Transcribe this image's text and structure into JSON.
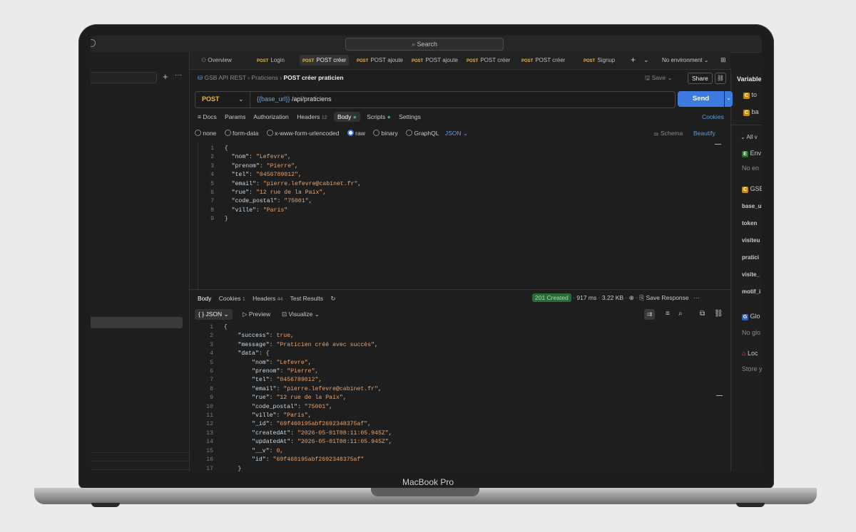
{
  "device": {
    "brand": "MacBook Pro"
  },
  "titlebar": {
    "search_placeholder": "Search"
  },
  "tabs": [
    {
      "method": "",
      "label": "Overview",
      "icon": "people-icon"
    },
    {
      "method": "POST",
      "label": "Login"
    },
    {
      "method": "POST",
      "label": "POST créer"
    },
    {
      "method": "POST",
      "label": "POST ajoute"
    },
    {
      "method": "POST",
      "label": "POST ajoute"
    },
    {
      "method": "POST",
      "label": "POST créer"
    },
    {
      "method": "POST",
      "label": "POST créer"
    },
    {
      "method": "POST",
      "label": "Signup"
    }
  ],
  "environment": {
    "label": "No environment"
  },
  "breadcrumb": {
    "collection": "GSB API REST",
    "folder": "Praticiens",
    "current": "POST créer praticien",
    "save": "Save",
    "share": "Share"
  },
  "request": {
    "method": "POST",
    "url_var": "{{base_url}}",
    "url_path": " /api/praticiens",
    "send": "Send"
  },
  "req_tabs": {
    "docs": "Docs",
    "params": "Params",
    "authorization": "Authorization",
    "headers": "Headers",
    "headers_count": "12",
    "body": "Body",
    "scripts": "Scripts",
    "settings": "Settings",
    "cookies": "Cookies"
  },
  "body_types": {
    "none": "none",
    "form_data": "form-data",
    "urlencoded": "x-www-form-urlencoded",
    "raw": "raw",
    "binary": "binary",
    "graphql": "GraphQL",
    "json": "JSON",
    "schema": "Schema",
    "beautify": "Beautify"
  },
  "request_body": [
    {
      "n": "1",
      "parts": [
        [
          "punc",
          "{"
        ]
      ]
    },
    {
      "n": "2",
      "parts": [
        [
          "key",
          "  \"nom\""
        ],
        [
          "punc",
          ": "
        ],
        [
          "str",
          "\"Lefevre\""
        ],
        [
          "punc",
          ","
        ]
      ]
    },
    {
      "n": "3",
      "parts": [
        [
          "key",
          "  \"prenom\""
        ],
        [
          "punc",
          ": "
        ],
        [
          "str",
          "\"Pierre\""
        ],
        [
          "punc",
          ","
        ]
      ]
    },
    {
      "n": "4",
      "parts": [
        [
          "key",
          "  \"tel\""
        ],
        [
          "punc",
          ": "
        ],
        [
          "str",
          "\"0456789012\""
        ],
        [
          "punc",
          ","
        ]
      ]
    },
    {
      "n": "5",
      "parts": [
        [
          "key",
          "  \"email\""
        ],
        [
          "punc",
          ": "
        ],
        [
          "str",
          "\"pierre.lefevre@cabinet.fr\""
        ],
        [
          "punc",
          ","
        ]
      ]
    },
    {
      "n": "6",
      "parts": [
        [
          "key",
          "  \"rue\""
        ],
        [
          "punc",
          ": "
        ],
        [
          "str",
          "\"12 rue de la Paix\""
        ],
        [
          "punc",
          ","
        ]
      ]
    },
    {
      "n": "7",
      "parts": [
        [
          "key",
          "  \"code_postal\""
        ],
        [
          "punc",
          ": "
        ],
        [
          "str",
          "\"75001\""
        ],
        [
          "punc",
          ","
        ]
      ]
    },
    {
      "n": "8",
      "parts": [
        [
          "key",
          "  \"ville\""
        ],
        [
          "punc",
          ": "
        ],
        [
          "str",
          "\"Paris\""
        ]
      ]
    },
    {
      "n": "9",
      "parts": [
        [
          "punc",
          "}"
        ]
      ]
    }
  ],
  "response": {
    "tabs": {
      "body": "Body",
      "cookies": "Cookies",
      "cookies_count": "1",
      "headers": "Headers",
      "headers_count": "44",
      "test_results": "Test Results"
    },
    "status": "201 Created",
    "time": "917 ms",
    "size": "3.22 KB",
    "save_response": "Save Response",
    "format": "JSON",
    "preview": "Preview",
    "visualize": "Visualize",
    "lines": [
      {
        "n": "1",
        "parts": [
          [
            "punc",
            "{"
          ]
        ]
      },
      {
        "n": "2",
        "parts": [
          [
            "key",
            "    \"success\""
          ],
          [
            "punc",
            ": "
          ],
          [
            "lit",
            "true"
          ],
          [
            "punc",
            ","
          ]
        ]
      },
      {
        "n": "3",
        "parts": [
          [
            "key",
            "    \"message\""
          ],
          [
            "punc",
            ": "
          ],
          [
            "str",
            "\"Praticien créé avec succès\""
          ],
          [
            "punc",
            ","
          ]
        ]
      },
      {
        "n": "4",
        "parts": [
          [
            "key",
            "    \"data\""
          ],
          [
            "punc",
            ": {"
          ]
        ]
      },
      {
        "n": "5",
        "parts": [
          [
            "key",
            "        \"nom\""
          ],
          [
            "punc",
            ": "
          ],
          [
            "str",
            "\"Lefevre\""
          ],
          [
            "punc",
            ","
          ]
        ]
      },
      {
        "n": "6",
        "parts": [
          [
            "key",
            "        \"prenom\""
          ],
          [
            "punc",
            ": "
          ],
          [
            "str",
            "\"Pierre\""
          ],
          [
            "punc",
            ","
          ]
        ]
      },
      {
        "n": "7",
        "parts": [
          [
            "key",
            "        \"tel\""
          ],
          [
            "punc",
            ": "
          ],
          [
            "str",
            "\"0456789012\""
          ],
          [
            "punc",
            ","
          ]
        ]
      },
      {
        "n": "8",
        "parts": [
          [
            "key",
            "        \"email\""
          ],
          [
            "punc",
            ": "
          ],
          [
            "str",
            "\"pierre.lefevre@cabinet.fr\""
          ],
          [
            "punc",
            ","
          ]
        ]
      },
      {
        "n": "9",
        "parts": [
          [
            "key",
            "        \"rue\""
          ],
          [
            "punc",
            ": "
          ],
          [
            "str",
            "\"12 rue de la Paix\""
          ],
          [
            "punc",
            ","
          ]
        ]
      },
      {
        "n": "10",
        "parts": [
          [
            "key",
            "        \"code_postal\""
          ],
          [
            "punc",
            ": "
          ],
          [
            "str",
            "\"75001\""
          ],
          [
            "punc",
            ","
          ]
        ]
      },
      {
        "n": "11",
        "parts": [
          [
            "key",
            "        \"ville\""
          ],
          [
            "punc",
            ": "
          ],
          [
            "str",
            "\"Paris\""
          ],
          [
            "punc",
            ","
          ]
        ]
      },
      {
        "n": "12",
        "parts": [
          [
            "key",
            "        \"_id\""
          ],
          [
            "punc",
            ": "
          ],
          [
            "str",
            "\"69f460195abf2692348375af\""
          ],
          [
            "punc",
            ","
          ]
        ]
      },
      {
        "n": "13",
        "parts": [
          [
            "key",
            "        \"createdAt\""
          ],
          [
            "punc",
            ": "
          ],
          [
            "str",
            "\"2026-05-01T08:11:05.945Z\""
          ],
          [
            "punc",
            ","
          ]
        ]
      },
      {
        "n": "14",
        "parts": [
          [
            "key",
            "        \"updatedAt\""
          ],
          [
            "punc",
            ": "
          ],
          [
            "str",
            "\"2026-05-01T08:11:05.945Z\""
          ],
          [
            "punc",
            ","
          ]
        ]
      },
      {
        "n": "15",
        "parts": [
          [
            "key",
            "        \"__v\""
          ],
          [
            "punc",
            ": "
          ],
          [
            "lit",
            "0"
          ],
          [
            "punc",
            ","
          ]
        ]
      },
      {
        "n": "16",
        "parts": [
          [
            "key",
            "        \"id\""
          ],
          [
            "punc",
            ": "
          ],
          [
            "str",
            "\"69f460195abf2692348375af\""
          ]
        ]
      },
      {
        "n": "17",
        "parts": [
          [
            "punc",
            "    }"
          ]
        ]
      }
    ]
  },
  "variables_panel": {
    "title": "Variable",
    "items": [
      "to",
      "ba"
    ],
    "all_vars": "All v",
    "env_label": "Env",
    "env_empty": "No en",
    "collection_label": "GSB",
    "collection_vars": [
      "base_u",
      "token",
      "visiteu",
      "pratici",
      "visite_",
      "motif_i"
    ],
    "global_label": "Glo",
    "global_empty": "No glo",
    "local_label": "Loc",
    "local_empty": "Store y"
  },
  "colors": {
    "accent": "#3d7be0",
    "status_bg": "#2d6a3a",
    "status_text": "#9fe0a9",
    "method": "#e8b84a"
  }
}
